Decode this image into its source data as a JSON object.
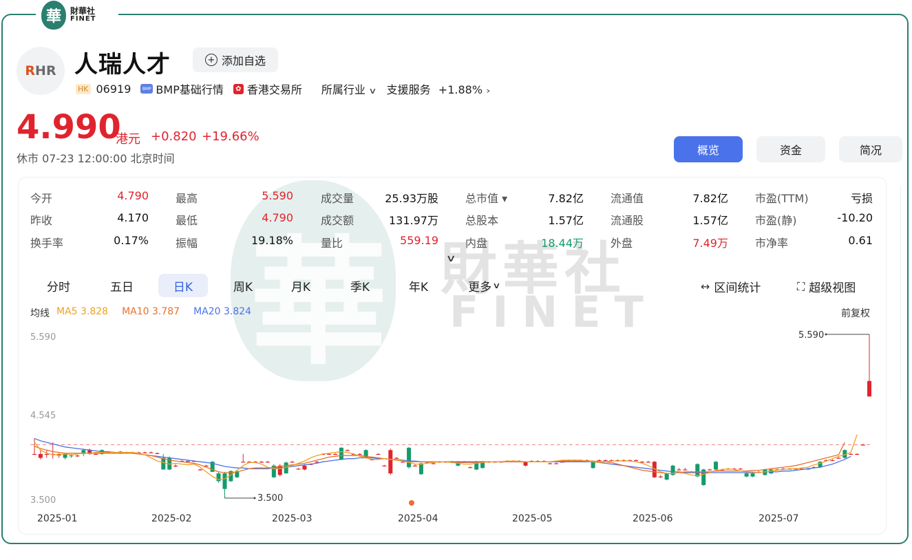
{
  "brand": {
    "seal_char": "華",
    "name_cn": "財華社",
    "name_en": "FINET"
  },
  "stock": {
    "logo_text_a": "R",
    "logo_text_b": "HR",
    "name": "人瑞人才",
    "watch_label": "添加自选",
    "market_badge": "HK",
    "code": "06919",
    "quote_source": "BMP基础行情",
    "exchange": "香港交易所",
    "industry_label": "所属行业",
    "sector": "支援服务",
    "sector_change": "+1.88%"
  },
  "quote": {
    "price": "4.990",
    "unit": "港元",
    "change": "+0.820",
    "change_pct": "+19.66%",
    "status": "休市 07-23 12:00:00 北京时间"
  },
  "tabs": [
    "概览",
    "资金",
    "简况"
  ],
  "stats": [
    [
      {
        "label": "今开",
        "value": "4.790",
        "color": "red"
      },
      {
        "label": "最高",
        "value": "5.590",
        "color": "red"
      },
      {
        "label": "成交量",
        "value": "25.93万股",
        "color": "black"
      },
      {
        "label": "总市值",
        "value": "7.82亿",
        "color": "black",
        "has_dropdown": true
      },
      {
        "label": "流通值",
        "value": "7.82亿",
        "color": "black"
      },
      {
        "label": "市盈(TTM)",
        "value": "亏损",
        "color": "black"
      }
    ],
    [
      {
        "label": "昨收",
        "value": "4.170",
        "color": "black"
      },
      {
        "label": "最低",
        "value": "4.790",
        "color": "red"
      },
      {
        "label": "成交额",
        "value": "131.97万",
        "color": "black"
      },
      {
        "label": "总股本",
        "value": "1.57亿",
        "color": "black"
      },
      {
        "label": "流通股",
        "value": "1.57亿",
        "color": "black"
      },
      {
        "label": "市盈(静)",
        "value": "-10.20",
        "color": "black"
      }
    ],
    [
      {
        "label": "换手率",
        "value": "0.17%",
        "color": "black"
      },
      {
        "label": "振幅",
        "value": "19.18%",
        "color": "black"
      },
      {
        "label": "量比",
        "value": "559.19",
        "color": "red"
      },
      {
        "label": "内盘",
        "value": "18.44万",
        "color": "green"
      },
      {
        "label": "外盘",
        "value": "7.49万",
        "color": "red"
      },
      {
        "label": "市净率",
        "value": "0.61",
        "color": "black"
      }
    ]
  ],
  "periods": [
    "分时",
    "五日",
    "日K",
    "周K",
    "月K",
    "季K",
    "年K",
    "更多"
  ],
  "tools": {
    "range_stats": "区间统计",
    "super_view": "超级视图"
  },
  "ma_legend": {
    "title": "均线",
    "ma5": "MA5 3.828",
    "ma10": "MA10 3.787",
    "ma20": "MA20 3.824",
    "adjust": "前复权"
  },
  "colors": {
    "up": "#e0242d",
    "down": "#159b6b",
    "ma5": "#f0a020",
    "ma10": "#e8702a",
    "ma20": "#4a72ea",
    "brand": "#2a7f6f",
    "accent": "#4a72ea"
  },
  "chart_data": {
    "type": "candlestick",
    "y_ticks": [
      "5.590",
      "4.545",
      "3.500"
    ],
    "ylim": [
      3.5,
      5.59
    ],
    "x_ticks": [
      "2025-01",
      "2025-02",
      "2025-03",
      "2025-04",
      "2025-05",
      "2025-06",
      "2025-07"
    ],
    "annotations": {
      "high": "5.590",
      "low": "3.500"
    },
    "reference_price": 4.17,
    "candles": [
      [
        4.05,
        4.05,
        4.25,
        4.05
      ],
      [
        4.0,
        4.05,
        4.1,
        3.98
      ],
      [
        4.05,
        4.05,
        4.1,
        4.0
      ],
      [
        4.05,
        4.05,
        4.2,
        3.99
      ],
      [
        4.03,
        4.05,
        4.06,
        4.0
      ],
      [
        4.05,
        4.0,
        4.06,
        3.98
      ],
      [
        4.03,
        4.02,
        4.05,
        4.0
      ],
      [
        4.03,
        4.03,
        4.04,
        4.01
      ],
      [
        4.1,
        4.05,
        4.12,
        4.02
      ],
      [
        4.05,
        4.1,
        4.12,
        4.04
      ],
      [
        4.05,
        4.05,
        4.06,
        4.04
      ],
      [
        4.1,
        4.05,
        4.11,
        4.04
      ],
      [
        4.07,
        4.07,
        4.08,
        4.06
      ],
      [
        4.07,
        4.07,
        4.08,
        4.06
      ],
      [
        4.08,
        4.06,
        4.09,
        4.05
      ],
      [
        4.07,
        4.07,
        4.08,
        4.06
      ],
      [
        4.07,
        4.07,
        4.08,
        4.06
      ],
      [
        4.07,
        4.07,
        4.08,
        4.06
      ],
      [
        4.07,
        4.07,
        4.08,
        4.06
      ],
      [
        4.07,
        4.07,
        4.08,
        4.06
      ],
      [
        4.06,
        4.06,
        4.07,
        4.05
      ],
      [
        4.0,
        3.85,
        4.05,
        3.85
      ],
      [
        4.0,
        3.85,
        4.02,
        3.84
      ],
      [
        3.9,
        3.9,
        3.92,
        3.88
      ],
      [
        3.96,
        3.96,
        3.97,
        3.95
      ],
      [
        3.96,
        3.96,
        3.97,
        3.95
      ],
      [
        3.96,
        3.96,
        3.97,
        3.95
      ],
      [
        3.85,
        3.85,
        3.86,
        3.84
      ],
      [
        3.9,
        3.9,
        3.91,
        3.89
      ],
      [
        3.95,
        3.82,
        3.96,
        3.82
      ],
      [
        3.8,
        3.7,
        3.82,
        3.68
      ],
      [
        3.8,
        3.6,
        3.82,
        3.5
      ],
      [
        3.83,
        3.7,
        3.84,
        3.69
      ],
      [
        3.83,
        3.75,
        3.84,
        3.74
      ],
      [
        3.95,
        3.95,
        4.05,
        3.95
      ],
      [
        3.95,
        3.95,
        3.96,
        3.94
      ],
      [
        3.95,
        3.95,
        3.96,
        3.94
      ],
      [
        3.95,
        3.95,
        3.96,
        3.94
      ],
      [
        3.95,
        3.95,
        3.96,
        3.94
      ],
      [
        3.9,
        3.75,
        3.92,
        3.74
      ],
      [
        3.78,
        3.9,
        3.92,
        3.76
      ],
      [
        3.94,
        3.8,
        3.95,
        3.8
      ],
      [
        3.95,
        3.95,
        3.96,
        3.94
      ],
      [
        3.86,
        3.86,
        3.87,
        3.85
      ],
      [
        3.85,
        3.9,
        3.92,
        3.84
      ],
      [
        3.92,
        3.92,
        3.93,
        3.91
      ],
      [
        3.95,
        3.95,
        3.96,
        3.94
      ],
      [
        4.05,
        4.05,
        4.06,
        4.04
      ],
      [
        4.05,
        4.05,
        4.06,
        4.04
      ],
      [
        4.05,
        4.05,
        4.06,
        4.04
      ],
      [
        4.13,
        3.98,
        4.14,
        3.97
      ],
      [
        4.1,
        4.1,
        4.11,
        4.09
      ],
      [
        4.05,
        4.05,
        4.06,
        4.04
      ],
      [
        4.05,
        4.05,
        4.06,
        4.04
      ],
      [
        4.1,
        4.0,
        4.11,
        3.99
      ],
      [
        3.98,
        3.98,
        3.99,
        3.97
      ],
      [
        4.05,
        4.05,
        4.06,
        4.04
      ],
      [
        3.9,
        3.9,
        3.91,
        3.89
      ],
      [
        3.8,
        4.1,
        4.12,
        3.78
      ],
      [
        4.0,
        4.0,
        4.01,
        3.99
      ],
      [
        3.95,
        3.95,
        3.96,
        3.94
      ],
      [
        4.13,
        3.88,
        4.14,
        3.86
      ],
      [
        3.9,
        3.9,
        3.92,
        3.89
      ],
      [
        3.93,
        3.79,
        3.94,
        3.78
      ],
      [
        3.94,
        3.94,
        3.95,
        3.93
      ],
      [
        3.93,
        3.93,
        3.94,
        3.92
      ],
      [
        3.95,
        3.95,
        3.96,
        3.94
      ],
      [
        3.95,
        3.95,
        3.96,
        3.94
      ],
      [
        3.95,
        3.95,
        3.96,
        3.94
      ],
      [
        3.95,
        3.9,
        3.96,
        3.89
      ],
      [
        3.95,
        3.95,
        3.96,
        3.94
      ],
      [
        3.88,
        3.88,
        3.89,
        3.87
      ],
      [
        3.95,
        3.85,
        3.96,
        3.84
      ],
      [
        3.95,
        3.87,
        3.96,
        3.86
      ],
      [
        3.95,
        3.95,
        3.96,
        3.94
      ],
      [
        3.95,
        3.95,
        3.96,
        3.94
      ],
      [
        3.95,
        3.95,
        3.96,
        3.94
      ],
      [
        3.96,
        3.96,
        3.97,
        3.95
      ],
      [
        3.96,
        3.96,
        3.97,
        3.95
      ],
      [
        3.96,
        3.96,
        3.97,
        3.95
      ],
      [
        3.9,
        3.95,
        3.96,
        3.89
      ],
      [
        3.96,
        3.96,
        3.97,
        3.95
      ],
      [
        3.96,
        3.96,
        3.97,
        3.95
      ],
      [
        3.96,
        3.96,
        3.97,
        3.95
      ],
      [
        3.93,
        3.93,
        3.94,
        3.92
      ],
      [
        3.93,
        3.93,
        3.94,
        3.92
      ],
      [
        3.95,
        3.95,
        3.96,
        3.94
      ],
      [
        3.97,
        3.97,
        3.98,
        3.96
      ],
      [
        3.97,
        3.97,
        3.98,
        3.96
      ],
      [
        3.97,
        3.97,
        3.98,
        3.96
      ],
      [
        3.97,
        3.97,
        3.98,
        3.96
      ],
      [
        3.95,
        3.87,
        3.96,
        3.86
      ],
      [
        3.97,
        3.97,
        3.98,
        3.96
      ],
      [
        3.97,
        3.97,
        3.98,
        3.96
      ],
      [
        3.97,
        3.97,
        3.98,
        3.96
      ],
      [
        3.97,
        3.97,
        3.98,
        3.96
      ],
      [
        3.97,
        3.97,
        3.98,
        3.96
      ],
      [
        3.97,
        3.97,
        3.98,
        3.96
      ],
      [
        3.97,
        3.97,
        3.98,
        3.96
      ],
      [
        3.95,
        3.95,
        3.96,
        3.94
      ],
      [
        3.95,
        3.95,
        3.96,
        3.94
      ],
      [
        3.75,
        3.95,
        3.96,
        3.74
      ],
      [
        3.76,
        3.76,
        3.78,
        3.74
      ],
      [
        3.8,
        3.72,
        3.81,
        3.71
      ],
      [
        3.9,
        3.78,
        3.91,
        3.77
      ],
      [
        3.85,
        3.85,
        3.87,
        3.84
      ],
      [
        3.85,
        3.85,
        3.87,
        3.84
      ],
      [
        3.82,
        3.82,
        3.83,
        3.81
      ],
      [
        3.92,
        3.76,
        3.93,
        3.75
      ],
      [
        3.85,
        3.65,
        3.86,
        3.64
      ],
      [
        3.85,
        3.85,
        3.86,
        3.84
      ],
      [
        3.95,
        3.85,
        3.96,
        3.84
      ],
      [
        3.85,
        3.85,
        3.86,
        3.84
      ],
      [
        3.86,
        3.86,
        3.87,
        3.85
      ],
      [
        3.86,
        3.86,
        3.87,
        3.85
      ],
      [
        3.86,
        3.86,
        3.87,
        3.85
      ],
      [
        3.8,
        3.76,
        3.81,
        3.75
      ],
      [
        3.8,
        3.76,
        3.81,
        3.75
      ],
      [
        3.82,
        3.82,
        3.83,
        3.81
      ],
      [
        3.85,
        3.78,
        3.86,
        3.77
      ],
      [
        3.85,
        3.8,
        3.86,
        3.79
      ],
      [
        3.85,
        3.85,
        3.86,
        3.84
      ],
      [
        3.86,
        3.86,
        3.87,
        3.85
      ],
      [
        3.86,
        3.86,
        3.87,
        3.85
      ],
      [
        3.86,
        3.86,
        3.87,
        3.85
      ],
      [
        3.86,
        3.86,
        3.87,
        3.85
      ],
      [
        3.86,
        3.86,
        3.87,
        3.85
      ],
      [
        3.88,
        3.88,
        3.89,
        3.87
      ],
      [
        3.95,
        3.88,
        3.96,
        3.87
      ],
      [
        3.97,
        3.97,
        3.98,
        3.96
      ],
      [
        3.97,
        3.97,
        3.98,
        3.96
      ],
      [
        4.0,
        4.0,
        4.01,
        3.99
      ],
      [
        4.1,
        4.0,
        4.11,
        3.99
      ],
      [
        4.05,
        4.05,
        4.06,
        4.04
      ],
      [
        4.05,
        4.05,
        4.06,
        4.04
      ],
      [
        4.17,
        4.17,
        4.18,
        4.16
      ],
      [
        4.79,
        4.99,
        5.59,
        4.79
      ]
    ],
    "ma5": [
      4.2,
      4.1,
      4.06,
      4.04,
      4.04,
      4.05,
      4.04,
      4.05,
      4.06,
      4.06,
      4.07,
      4.07,
      4.07,
      4.07,
      4.07,
      4.07,
      4.07,
      4.06,
      4.04,
      4.0,
      3.96,
      3.94,
      3.92,
      3.93,
      3.92,
      3.91,
      3.92,
      3.88,
      3.82,
      3.76,
      3.72,
      3.73,
      3.78,
      3.84,
      3.9,
      3.94,
      3.94,
      3.92,
      3.88,
      3.86,
      3.86,
      3.88,
      3.9,
      3.93,
      3.96,
      4.0,
      4.03,
      4.05,
      4.06,
      4.07,
      4.08,
      4.07,
      4.05,
      4.02,
      4.0,
      3.98,
      3.98,
      3.99,
      3.98,
      3.98,
      3.96,
      3.94,
      3.92,
      3.92,
      3.93,
      3.94,
      3.95,
      3.95,
      3.94,
      3.93,
      3.92,
      3.92,
      3.93,
      3.94,
      3.95,
      3.95,
      3.95,
      3.96,
      3.96,
      3.96,
      3.95,
      3.95,
      3.95,
      3.95,
      3.95,
      3.96,
      3.97,
      3.97,
      3.97,
      3.97,
      3.96,
      3.95,
      3.94,
      3.95,
      3.96,
      3.96,
      3.96,
      3.96,
      3.95,
      3.93,
      3.9,
      3.86,
      3.82,
      3.8,
      3.8,
      3.81,
      3.8,
      3.78,
      3.77,
      3.79,
      3.81,
      3.84,
      3.85,
      3.86,
      3.85,
      3.83,
      3.82,
      3.82,
      3.81,
      3.82,
      3.83,
      3.84,
      3.85,
      3.86,
      3.86,
      3.87,
      3.88,
      3.91,
      3.93,
      3.96,
      3.99,
      4.02,
      4.04,
      4.07,
      4.3
    ],
    "ma10": [
      4.15,
      4.12,
      4.1,
      4.08,
      4.07,
      4.06,
      4.06,
      4.06,
      4.06,
      4.06,
      4.06,
      4.06,
      4.06,
      4.06,
      4.06,
      4.06,
      4.06,
      4.05,
      4.04,
      4.03,
      4.01,
      3.99,
      3.97,
      3.96,
      3.95,
      3.94,
      3.93,
      3.91,
      3.88,
      3.85,
      3.82,
      3.81,
      3.81,
      3.82,
      3.84,
      3.86,
      3.87,
      3.87,
      3.87,
      3.88,
      3.89,
      3.9,
      3.91,
      3.92,
      3.93,
      3.95,
      3.97,
      3.99,
      4.01,
      4.02,
      4.03,
      4.03,
      4.03,
      4.03,
      4.02,
      4.01,
      4.0,
      3.99,
      3.98,
      3.97,
      3.96,
      3.95,
      3.95,
      3.95,
      3.95,
      3.95,
      3.95,
      3.95,
      3.94,
      3.94,
      3.94,
      3.94,
      3.94,
      3.94,
      3.95,
      3.95,
      3.95,
      3.95,
      3.95,
      3.95,
      3.95,
      3.95,
      3.95,
      3.95,
      3.95,
      3.96,
      3.96,
      3.96,
      3.96,
      3.96,
      3.96,
      3.96,
      3.95,
      3.95,
      3.94,
      3.92,
      3.9,
      3.88,
      3.86,
      3.84,
      3.83,
      3.82,
      3.81,
      3.8,
      3.8,
      3.81,
      3.82,
      3.82,
      3.82,
      3.82,
      3.82,
      3.83,
      3.83,
      3.83,
      3.83,
      3.83,
      3.83,
      3.84,
      3.84,
      3.85,
      3.86,
      3.87,
      3.88,
      3.89,
      3.9,
      3.92,
      3.94,
      3.96,
      3.98,
      4.0,
      4.02,
      4.04,
      4.2
    ],
    "ma20": [
      4.25,
      4.22,
      4.2,
      4.18,
      4.16,
      4.14,
      4.13,
      4.12,
      4.11,
      4.1,
      4.09,
      4.08,
      4.08,
      4.07,
      4.07,
      4.06,
      4.06,
      4.05,
      4.04,
      4.03,
      4.02,
      4.01,
      4.0,
      3.99,
      3.98,
      3.97,
      3.96,
      3.95,
      3.94,
      3.93,
      3.91,
      3.89,
      3.88,
      3.87,
      3.87,
      3.86,
      3.86,
      3.86,
      3.86,
      3.87,
      3.87,
      3.88,
      3.89,
      3.9,
      3.91,
      3.92,
      3.93,
      3.95,
      3.96,
      3.97,
      3.98,
      3.99,
      3.99,
      4.0,
      4.0,
      4.0,
      3.99,
      3.99,
      3.98,
      3.98,
      3.97,
      3.96,
      3.96,
      3.95,
      3.95,
      3.95,
      3.95,
      3.95,
      3.95,
      3.95,
      3.95,
      3.95,
      3.95,
      3.95,
      3.95,
      3.95,
      3.95,
      3.95,
      3.95,
      3.95,
      3.95,
      3.95,
      3.95,
      3.95,
      3.95,
      3.95,
      3.95,
      3.95,
      3.95,
      3.95,
      3.95,
      3.95,
      3.94,
      3.93,
      3.92,
      3.91,
      3.9,
      3.89,
      3.88,
      3.87,
      3.86,
      3.85,
      3.84,
      3.83,
      3.82,
      3.82,
      3.81,
      3.81,
      3.81,
      3.81,
      3.81,
      3.81,
      3.81,
      3.81,
      3.81,
      3.81,
      3.81,
      3.81,
      3.81,
      3.82,
      3.82,
      3.82,
      3.83,
      3.83,
      3.84,
      3.85,
      3.86,
      3.87,
      3.88,
      3.9,
      3.92,
      3.95,
      3.98,
      4.02
    ]
  }
}
